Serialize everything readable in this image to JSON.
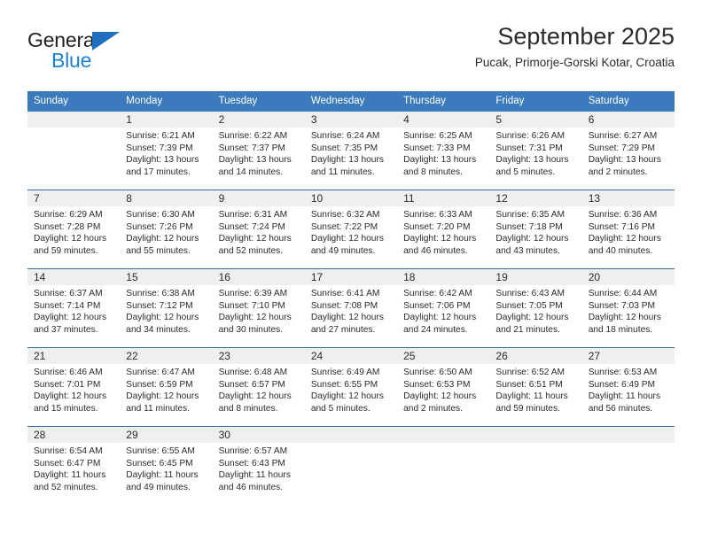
{
  "brand": {
    "name_top": "General",
    "name_bottom": "Blue",
    "accent_color": "#1f7fd0",
    "triangle_icon": "triangle-icon"
  },
  "header": {
    "title": "September 2025",
    "subtitle": "Pucak, Primorje-Gorski Kotar, Croatia"
  },
  "calendar": {
    "header_bg": "#3a7abd",
    "row_divider_color": "#2e6da8",
    "daynum_strip_bg": "#efefef",
    "weekday_headers": [
      "Sunday",
      "Monday",
      "Tuesday",
      "Wednesday",
      "Thursday",
      "Friday",
      "Saturday"
    ],
    "weeks": [
      [
        {
          "day": "",
          "sunrise": "",
          "sunset": "",
          "daylight_line1": "",
          "daylight_line2": ""
        },
        {
          "day": "1",
          "sunrise": "Sunrise: 6:21 AM",
          "sunset": "Sunset: 7:39 PM",
          "daylight_line1": "Daylight: 13 hours",
          "daylight_line2": "and 17 minutes."
        },
        {
          "day": "2",
          "sunrise": "Sunrise: 6:22 AM",
          "sunset": "Sunset: 7:37 PM",
          "daylight_line1": "Daylight: 13 hours",
          "daylight_line2": "and 14 minutes."
        },
        {
          "day": "3",
          "sunrise": "Sunrise: 6:24 AM",
          "sunset": "Sunset: 7:35 PM",
          "daylight_line1": "Daylight: 13 hours",
          "daylight_line2": "and 11 minutes."
        },
        {
          "day": "4",
          "sunrise": "Sunrise: 6:25 AM",
          "sunset": "Sunset: 7:33 PM",
          "daylight_line1": "Daylight: 13 hours",
          "daylight_line2": "and 8 minutes."
        },
        {
          "day": "5",
          "sunrise": "Sunrise: 6:26 AM",
          "sunset": "Sunset: 7:31 PM",
          "daylight_line1": "Daylight: 13 hours",
          "daylight_line2": "and 5 minutes."
        },
        {
          "day": "6",
          "sunrise": "Sunrise: 6:27 AM",
          "sunset": "Sunset: 7:29 PM",
          "daylight_line1": "Daylight: 13 hours",
          "daylight_line2": "and 2 minutes."
        }
      ],
      [
        {
          "day": "7",
          "sunrise": "Sunrise: 6:29 AM",
          "sunset": "Sunset: 7:28 PM",
          "daylight_line1": "Daylight: 12 hours",
          "daylight_line2": "and 59 minutes."
        },
        {
          "day": "8",
          "sunrise": "Sunrise: 6:30 AM",
          "sunset": "Sunset: 7:26 PM",
          "daylight_line1": "Daylight: 12 hours",
          "daylight_line2": "and 55 minutes."
        },
        {
          "day": "9",
          "sunrise": "Sunrise: 6:31 AM",
          "sunset": "Sunset: 7:24 PM",
          "daylight_line1": "Daylight: 12 hours",
          "daylight_line2": "and 52 minutes."
        },
        {
          "day": "10",
          "sunrise": "Sunrise: 6:32 AM",
          "sunset": "Sunset: 7:22 PM",
          "daylight_line1": "Daylight: 12 hours",
          "daylight_line2": "and 49 minutes."
        },
        {
          "day": "11",
          "sunrise": "Sunrise: 6:33 AM",
          "sunset": "Sunset: 7:20 PM",
          "daylight_line1": "Daylight: 12 hours",
          "daylight_line2": "and 46 minutes."
        },
        {
          "day": "12",
          "sunrise": "Sunrise: 6:35 AM",
          "sunset": "Sunset: 7:18 PM",
          "daylight_line1": "Daylight: 12 hours",
          "daylight_line2": "and 43 minutes."
        },
        {
          "day": "13",
          "sunrise": "Sunrise: 6:36 AM",
          "sunset": "Sunset: 7:16 PM",
          "daylight_line1": "Daylight: 12 hours",
          "daylight_line2": "and 40 minutes."
        }
      ],
      [
        {
          "day": "14",
          "sunrise": "Sunrise: 6:37 AM",
          "sunset": "Sunset: 7:14 PM",
          "daylight_line1": "Daylight: 12 hours",
          "daylight_line2": "and 37 minutes."
        },
        {
          "day": "15",
          "sunrise": "Sunrise: 6:38 AM",
          "sunset": "Sunset: 7:12 PM",
          "daylight_line1": "Daylight: 12 hours",
          "daylight_line2": "and 34 minutes."
        },
        {
          "day": "16",
          "sunrise": "Sunrise: 6:39 AM",
          "sunset": "Sunset: 7:10 PM",
          "daylight_line1": "Daylight: 12 hours",
          "daylight_line2": "and 30 minutes."
        },
        {
          "day": "17",
          "sunrise": "Sunrise: 6:41 AM",
          "sunset": "Sunset: 7:08 PM",
          "daylight_line1": "Daylight: 12 hours",
          "daylight_line2": "and 27 minutes."
        },
        {
          "day": "18",
          "sunrise": "Sunrise: 6:42 AM",
          "sunset": "Sunset: 7:06 PM",
          "daylight_line1": "Daylight: 12 hours",
          "daylight_line2": "and 24 minutes."
        },
        {
          "day": "19",
          "sunrise": "Sunrise: 6:43 AM",
          "sunset": "Sunset: 7:05 PM",
          "daylight_line1": "Daylight: 12 hours",
          "daylight_line2": "and 21 minutes."
        },
        {
          "day": "20",
          "sunrise": "Sunrise: 6:44 AM",
          "sunset": "Sunset: 7:03 PM",
          "daylight_line1": "Daylight: 12 hours",
          "daylight_line2": "and 18 minutes."
        }
      ],
      [
        {
          "day": "21",
          "sunrise": "Sunrise: 6:46 AM",
          "sunset": "Sunset: 7:01 PM",
          "daylight_line1": "Daylight: 12 hours",
          "daylight_line2": "and 15 minutes."
        },
        {
          "day": "22",
          "sunrise": "Sunrise: 6:47 AM",
          "sunset": "Sunset: 6:59 PM",
          "daylight_line1": "Daylight: 12 hours",
          "daylight_line2": "and 11 minutes."
        },
        {
          "day": "23",
          "sunrise": "Sunrise: 6:48 AM",
          "sunset": "Sunset: 6:57 PM",
          "daylight_line1": "Daylight: 12 hours",
          "daylight_line2": "and 8 minutes."
        },
        {
          "day": "24",
          "sunrise": "Sunrise: 6:49 AM",
          "sunset": "Sunset: 6:55 PM",
          "daylight_line1": "Daylight: 12 hours",
          "daylight_line2": "and 5 minutes."
        },
        {
          "day": "25",
          "sunrise": "Sunrise: 6:50 AM",
          "sunset": "Sunset: 6:53 PM",
          "daylight_line1": "Daylight: 12 hours",
          "daylight_line2": "and 2 minutes."
        },
        {
          "day": "26",
          "sunrise": "Sunrise: 6:52 AM",
          "sunset": "Sunset: 6:51 PM",
          "daylight_line1": "Daylight: 11 hours",
          "daylight_line2": "and 59 minutes."
        },
        {
          "day": "27",
          "sunrise": "Sunrise: 6:53 AM",
          "sunset": "Sunset: 6:49 PM",
          "daylight_line1": "Daylight: 11 hours",
          "daylight_line2": "and 56 minutes."
        }
      ],
      [
        {
          "day": "28",
          "sunrise": "Sunrise: 6:54 AM",
          "sunset": "Sunset: 6:47 PM",
          "daylight_line1": "Daylight: 11 hours",
          "daylight_line2": "and 52 minutes."
        },
        {
          "day": "29",
          "sunrise": "Sunrise: 6:55 AM",
          "sunset": "Sunset: 6:45 PM",
          "daylight_line1": "Daylight: 11 hours",
          "daylight_line2": "and 49 minutes."
        },
        {
          "day": "30",
          "sunrise": "Sunrise: 6:57 AM",
          "sunset": "Sunset: 6:43 PM",
          "daylight_line1": "Daylight: 11 hours",
          "daylight_line2": "and 46 minutes."
        },
        {
          "day": "",
          "sunrise": "",
          "sunset": "",
          "daylight_line1": "",
          "daylight_line2": ""
        },
        {
          "day": "",
          "sunrise": "",
          "sunset": "",
          "daylight_line1": "",
          "daylight_line2": ""
        },
        {
          "day": "",
          "sunrise": "",
          "sunset": "",
          "daylight_line1": "",
          "daylight_line2": ""
        },
        {
          "day": "",
          "sunrise": "",
          "sunset": "",
          "daylight_line1": "",
          "daylight_line2": ""
        }
      ]
    ]
  }
}
